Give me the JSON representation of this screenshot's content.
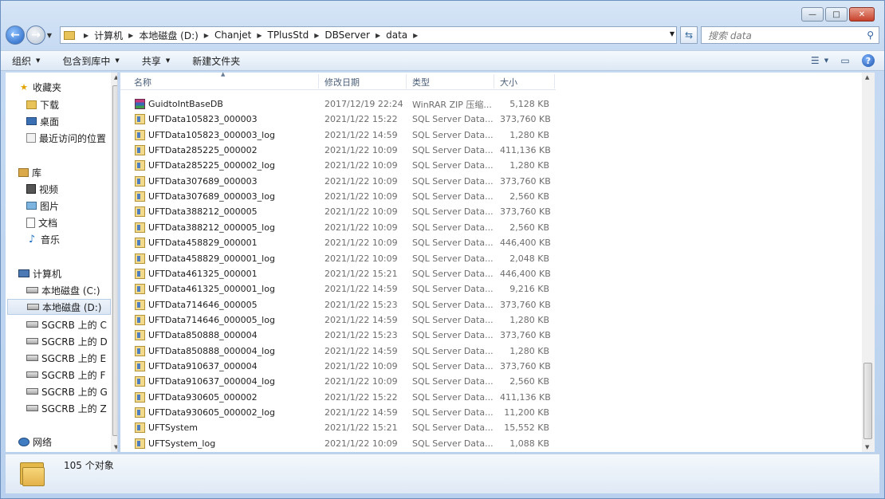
{
  "window": {
    "caption": {
      "minimize": "—",
      "maximize": "□",
      "close": "✕"
    }
  },
  "address": {
    "crumbs": [
      "计算机",
      "本地磁盘 (D:)",
      "Chanjet",
      "TPlusStd",
      "DBServer",
      "data"
    ]
  },
  "search": {
    "placeholder": "搜索 data"
  },
  "toolbar": {
    "organize": "组织",
    "include_library": "包含到库中",
    "share": "共享",
    "new_folder": "新建文件夹"
  },
  "nav": {
    "favorites": "收藏夹",
    "downloads": "下载",
    "desktop": "桌面",
    "recent": "最近访问的位置",
    "libraries": "库",
    "videos": "视频",
    "pictures": "图片",
    "documents": "文档",
    "music": "音乐",
    "computer": "计算机",
    "drive_c": "本地磁盘 (C:)",
    "drive_d": "本地磁盘 (D:)",
    "net_c": "SGCRB 上的 C",
    "net_d": "SGCRB 上的 D",
    "net_e": "SGCRB 上的 E",
    "net_f": "SGCRB 上的 F",
    "net_g": "SGCRB 上的 G",
    "net_z": "SGCRB 上的 Z",
    "network": "网络"
  },
  "columns": {
    "name": "名称",
    "modified": "修改日期",
    "type": "类型",
    "size": "大小"
  },
  "files": [
    {
      "name": "GuidtoIntBaseDB",
      "date": "2017/12/19 22:24",
      "type": "WinRAR ZIP 压缩...",
      "size": "5,128 KB",
      "icon": "rar"
    },
    {
      "name": "UFTData105823_000003",
      "date": "2021/1/22 15:22",
      "type": "SQL Server Data...",
      "size": "373,760 KB",
      "icon": "sql"
    },
    {
      "name": "UFTData105823_000003_log",
      "date": "2021/1/22 14:59",
      "type": "SQL Server Data...",
      "size": "1,280 KB",
      "icon": "sql"
    },
    {
      "name": "UFTData285225_000002",
      "date": "2021/1/22 10:09",
      "type": "SQL Server Data...",
      "size": "411,136 KB",
      "icon": "sql"
    },
    {
      "name": "UFTData285225_000002_log",
      "date": "2021/1/22 10:09",
      "type": "SQL Server Data...",
      "size": "1,280 KB",
      "icon": "sql"
    },
    {
      "name": "UFTData307689_000003",
      "date": "2021/1/22 10:09",
      "type": "SQL Server Data...",
      "size": "373,760 KB",
      "icon": "sql"
    },
    {
      "name": "UFTData307689_000003_log",
      "date": "2021/1/22 10:09",
      "type": "SQL Server Data...",
      "size": "2,560 KB",
      "icon": "sql"
    },
    {
      "name": "UFTData388212_000005",
      "date": "2021/1/22 10:09",
      "type": "SQL Server Data...",
      "size": "373,760 KB",
      "icon": "sql"
    },
    {
      "name": "UFTData388212_000005_log",
      "date": "2021/1/22 10:09",
      "type": "SQL Server Data...",
      "size": "2,560 KB",
      "icon": "sql"
    },
    {
      "name": "UFTData458829_000001",
      "date": "2021/1/22 10:09",
      "type": "SQL Server Data...",
      "size": "446,400 KB",
      "icon": "sql"
    },
    {
      "name": "UFTData458829_000001_log",
      "date": "2021/1/22 10:09",
      "type": "SQL Server Data...",
      "size": "2,048 KB",
      "icon": "sql"
    },
    {
      "name": "UFTData461325_000001",
      "date": "2021/1/22 15:21",
      "type": "SQL Server Data...",
      "size": "446,400 KB",
      "icon": "sql"
    },
    {
      "name": "UFTData461325_000001_log",
      "date": "2021/1/22 14:59",
      "type": "SQL Server Data...",
      "size": "9,216 KB",
      "icon": "sql"
    },
    {
      "name": "UFTData714646_000005",
      "date": "2021/1/22 15:23",
      "type": "SQL Server Data...",
      "size": "373,760 KB",
      "icon": "sql"
    },
    {
      "name": "UFTData714646_000005_log",
      "date": "2021/1/22 14:59",
      "type": "SQL Server Data...",
      "size": "1,280 KB",
      "icon": "sql"
    },
    {
      "name": "UFTData850888_000004",
      "date": "2021/1/22 15:23",
      "type": "SQL Server Data...",
      "size": "373,760 KB",
      "icon": "sql"
    },
    {
      "name": "UFTData850888_000004_log",
      "date": "2021/1/22 14:59",
      "type": "SQL Server Data...",
      "size": "1,280 KB",
      "icon": "sql"
    },
    {
      "name": "UFTData910637_000004",
      "date": "2021/1/22 10:09",
      "type": "SQL Server Data...",
      "size": "373,760 KB",
      "icon": "sql"
    },
    {
      "name": "UFTData910637_000004_log",
      "date": "2021/1/22 10:09",
      "type": "SQL Server Data...",
      "size": "2,560 KB",
      "icon": "sql"
    },
    {
      "name": "UFTData930605_000002",
      "date": "2021/1/22 15:22",
      "type": "SQL Server Data...",
      "size": "411,136 KB",
      "icon": "sql"
    },
    {
      "name": "UFTData930605_000002_log",
      "date": "2021/1/22 14:59",
      "type": "SQL Server Data...",
      "size": "11,200 KB",
      "icon": "sql"
    },
    {
      "name": "UFTSystem",
      "date": "2021/1/22 15:21",
      "type": "SQL Server Data...",
      "size": "15,552 KB",
      "icon": "sql"
    },
    {
      "name": "UFTSystem_log",
      "date": "2021/1/22 10:09",
      "type": "SQL Server Data...",
      "size": "1,088 KB",
      "icon": "sql"
    }
  ],
  "details": {
    "count": "105 个对象"
  }
}
